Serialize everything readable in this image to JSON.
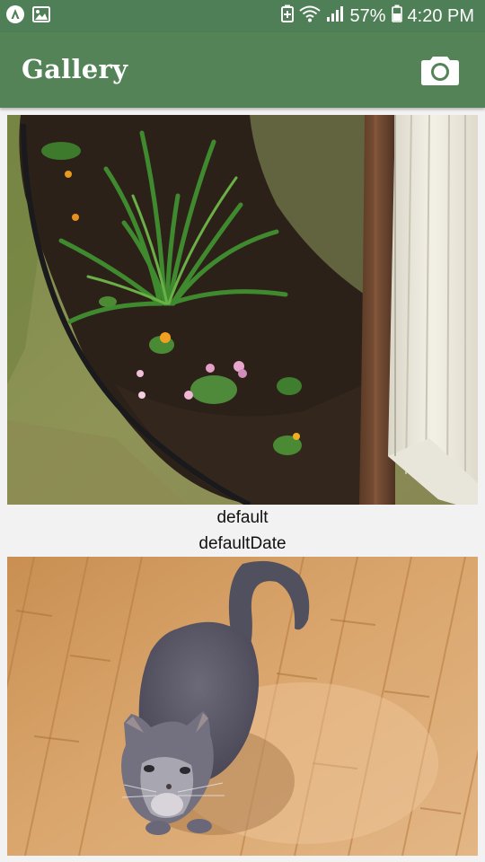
{
  "status_bar": {
    "battery_percent": "57%",
    "time": "4:20 PM",
    "icons": [
      "app-notification-icon",
      "image-notification-icon",
      "battery-saver-icon",
      "wifi-icon",
      "signal-icon",
      "battery-icon"
    ]
  },
  "app_bar": {
    "title": "Gallery",
    "camera_icon": "camera-icon",
    "colors": {
      "primary": "#548358",
      "status": "#4e7f57"
    }
  },
  "gallery": {
    "items": [
      {
        "title": "default",
        "date": "defaultDate",
        "subject": "garden bed with daylilies, flowers and hose"
      },
      {
        "subject": "grey cat on bamboo floor"
      }
    ]
  }
}
